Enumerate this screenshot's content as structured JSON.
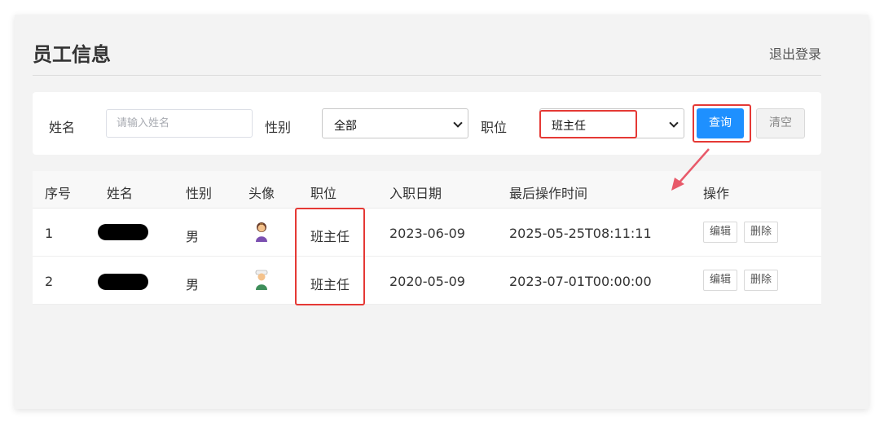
{
  "header": {
    "title": "员工信息",
    "logout_label": "退出登录"
  },
  "filters": {
    "name_label": "姓名",
    "name_placeholder": "请输入姓名",
    "gender_label": "性别",
    "gender_value": "全部",
    "position_label": "职位",
    "position_value": "班主任",
    "query_label": "查询",
    "clear_label": "清空"
  },
  "table": {
    "columns": [
      "序号",
      "姓名",
      "性别",
      "头像",
      "职位",
      "入职日期",
      "最后操作时间",
      "操作"
    ],
    "rows": [
      {
        "index": "1",
        "gender": "男",
        "position": "班主任",
        "entry_date": "2023-06-09",
        "last_op": "2025-05-25T08:11:11",
        "edit": "编辑",
        "delete": "删除"
      },
      {
        "index": "2",
        "gender": "男",
        "position": "班主任",
        "entry_date": "2020-05-09",
        "last_op": "2023-07-01T00:00:00",
        "edit": "编辑",
        "delete": "删除"
      }
    ]
  },
  "annotation_color": "#e53935",
  "primary_color": "#1e90ff"
}
